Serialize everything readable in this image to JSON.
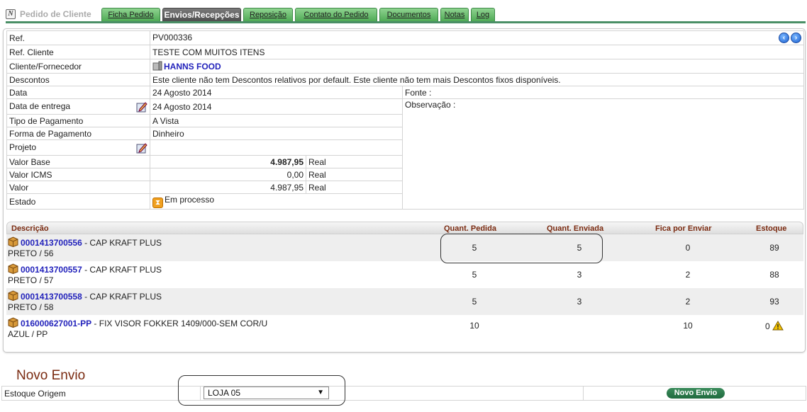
{
  "tabs": {
    "title": "Pedido de Cliente",
    "items": [
      {
        "label": "Ficha Pedido"
      },
      {
        "label": "Envios/Recepções"
      },
      {
        "label": "Reposição"
      },
      {
        "label": "Contato do Pedido"
      },
      {
        "label": "Documentos"
      },
      {
        "label": "Notas"
      },
      {
        "label": "Log"
      }
    ],
    "active": "Envios/Recepções"
  },
  "info": {
    "ref_label": "Ref.",
    "ref_value": "PV000336",
    "ref_cliente_label": "Ref. Cliente",
    "ref_cliente_value": "TESTE COM MUITOS ITENS",
    "cliente_label": "Cliente/Fornecedor",
    "cliente_value": "HANNS FOOD",
    "descontos_label": "Descontos",
    "descontos_value": "Este cliente não tem Descontos relativos por default. Este cliente não tem mais Descontos fixos disponíveis.",
    "data_label": "Data",
    "data_value": "24 Agosto 2014",
    "fonte_label": "Fonte :",
    "entrega_label": "Data de entrega",
    "entrega_value": "24 Agosto 2014",
    "observacao_label": "Observação :",
    "tipo_pag_label": "Tipo de Pagamento",
    "tipo_pag_value": "A Vista",
    "forma_pag_label": "Forma de Pagamento",
    "forma_pag_value": "Dinheiro",
    "projeto_label": "Projeto",
    "valor_base_label": "Valor Base",
    "valor_base_value": "4.987,95",
    "valor_base_unit": "Real",
    "valor_icms_label": "Valor ICMS",
    "valor_icms_value": "0,00",
    "valor_icms_unit": "Real",
    "valor_label": "Valor",
    "valor_value": "4.987,95",
    "valor_unit": "Real",
    "estado_label": "Estado",
    "estado_value": "Em processo"
  },
  "items": {
    "headers": {
      "descricao": "Descrição",
      "pedida": "Quant. Pedida",
      "enviada": "Quant. Enviada",
      "fica": "Fica por Enviar",
      "estoque": "Estoque"
    },
    "rows": [
      {
        "code": "0001413700556",
        "name": " - CAP KRAFT PLUS",
        "variant": "PRETO / 56",
        "pedida": "5",
        "enviada": "5",
        "fica": "0",
        "estoque": "89"
      },
      {
        "code": "0001413700557",
        "name": " - CAP KRAFT PLUS",
        "variant": "PRETO / 57",
        "pedida": "5",
        "enviada": "3",
        "fica": "2",
        "estoque": "88"
      },
      {
        "code": "0001413700558",
        "name": " - CAP KRAFT PLUS",
        "variant": "PRETO / 58",
        "pedida": "5",
        "enviada": "3",
        "fica": "2",
        "estoque": "93"
      },
      {
        "code": "016000627001-PP",
        "name": " - FIX VISOR FOKKER 1409/000-SEM COR/U",
        "variant": "AZUL / PP",
        "pedida": "10",
        "enviada": "",
        "fica": "10",
        "estoque": "0"
      }
    ]
  },
  "novo_envio": {
    "title": "Novo Envio",
    "estoque_label": "Estoque Origem",
    "select_value": "LOJA 05",
    "button_label": "Novo Envio"
  },
  "colors": {
    "tab_green": "#4faa55",
    "tab_active": "#555555",
    "header_brown": "#7a2a10",
    "link_blue": "#2222bb",
    "button_green": "#1f6a3e"
  }
}
